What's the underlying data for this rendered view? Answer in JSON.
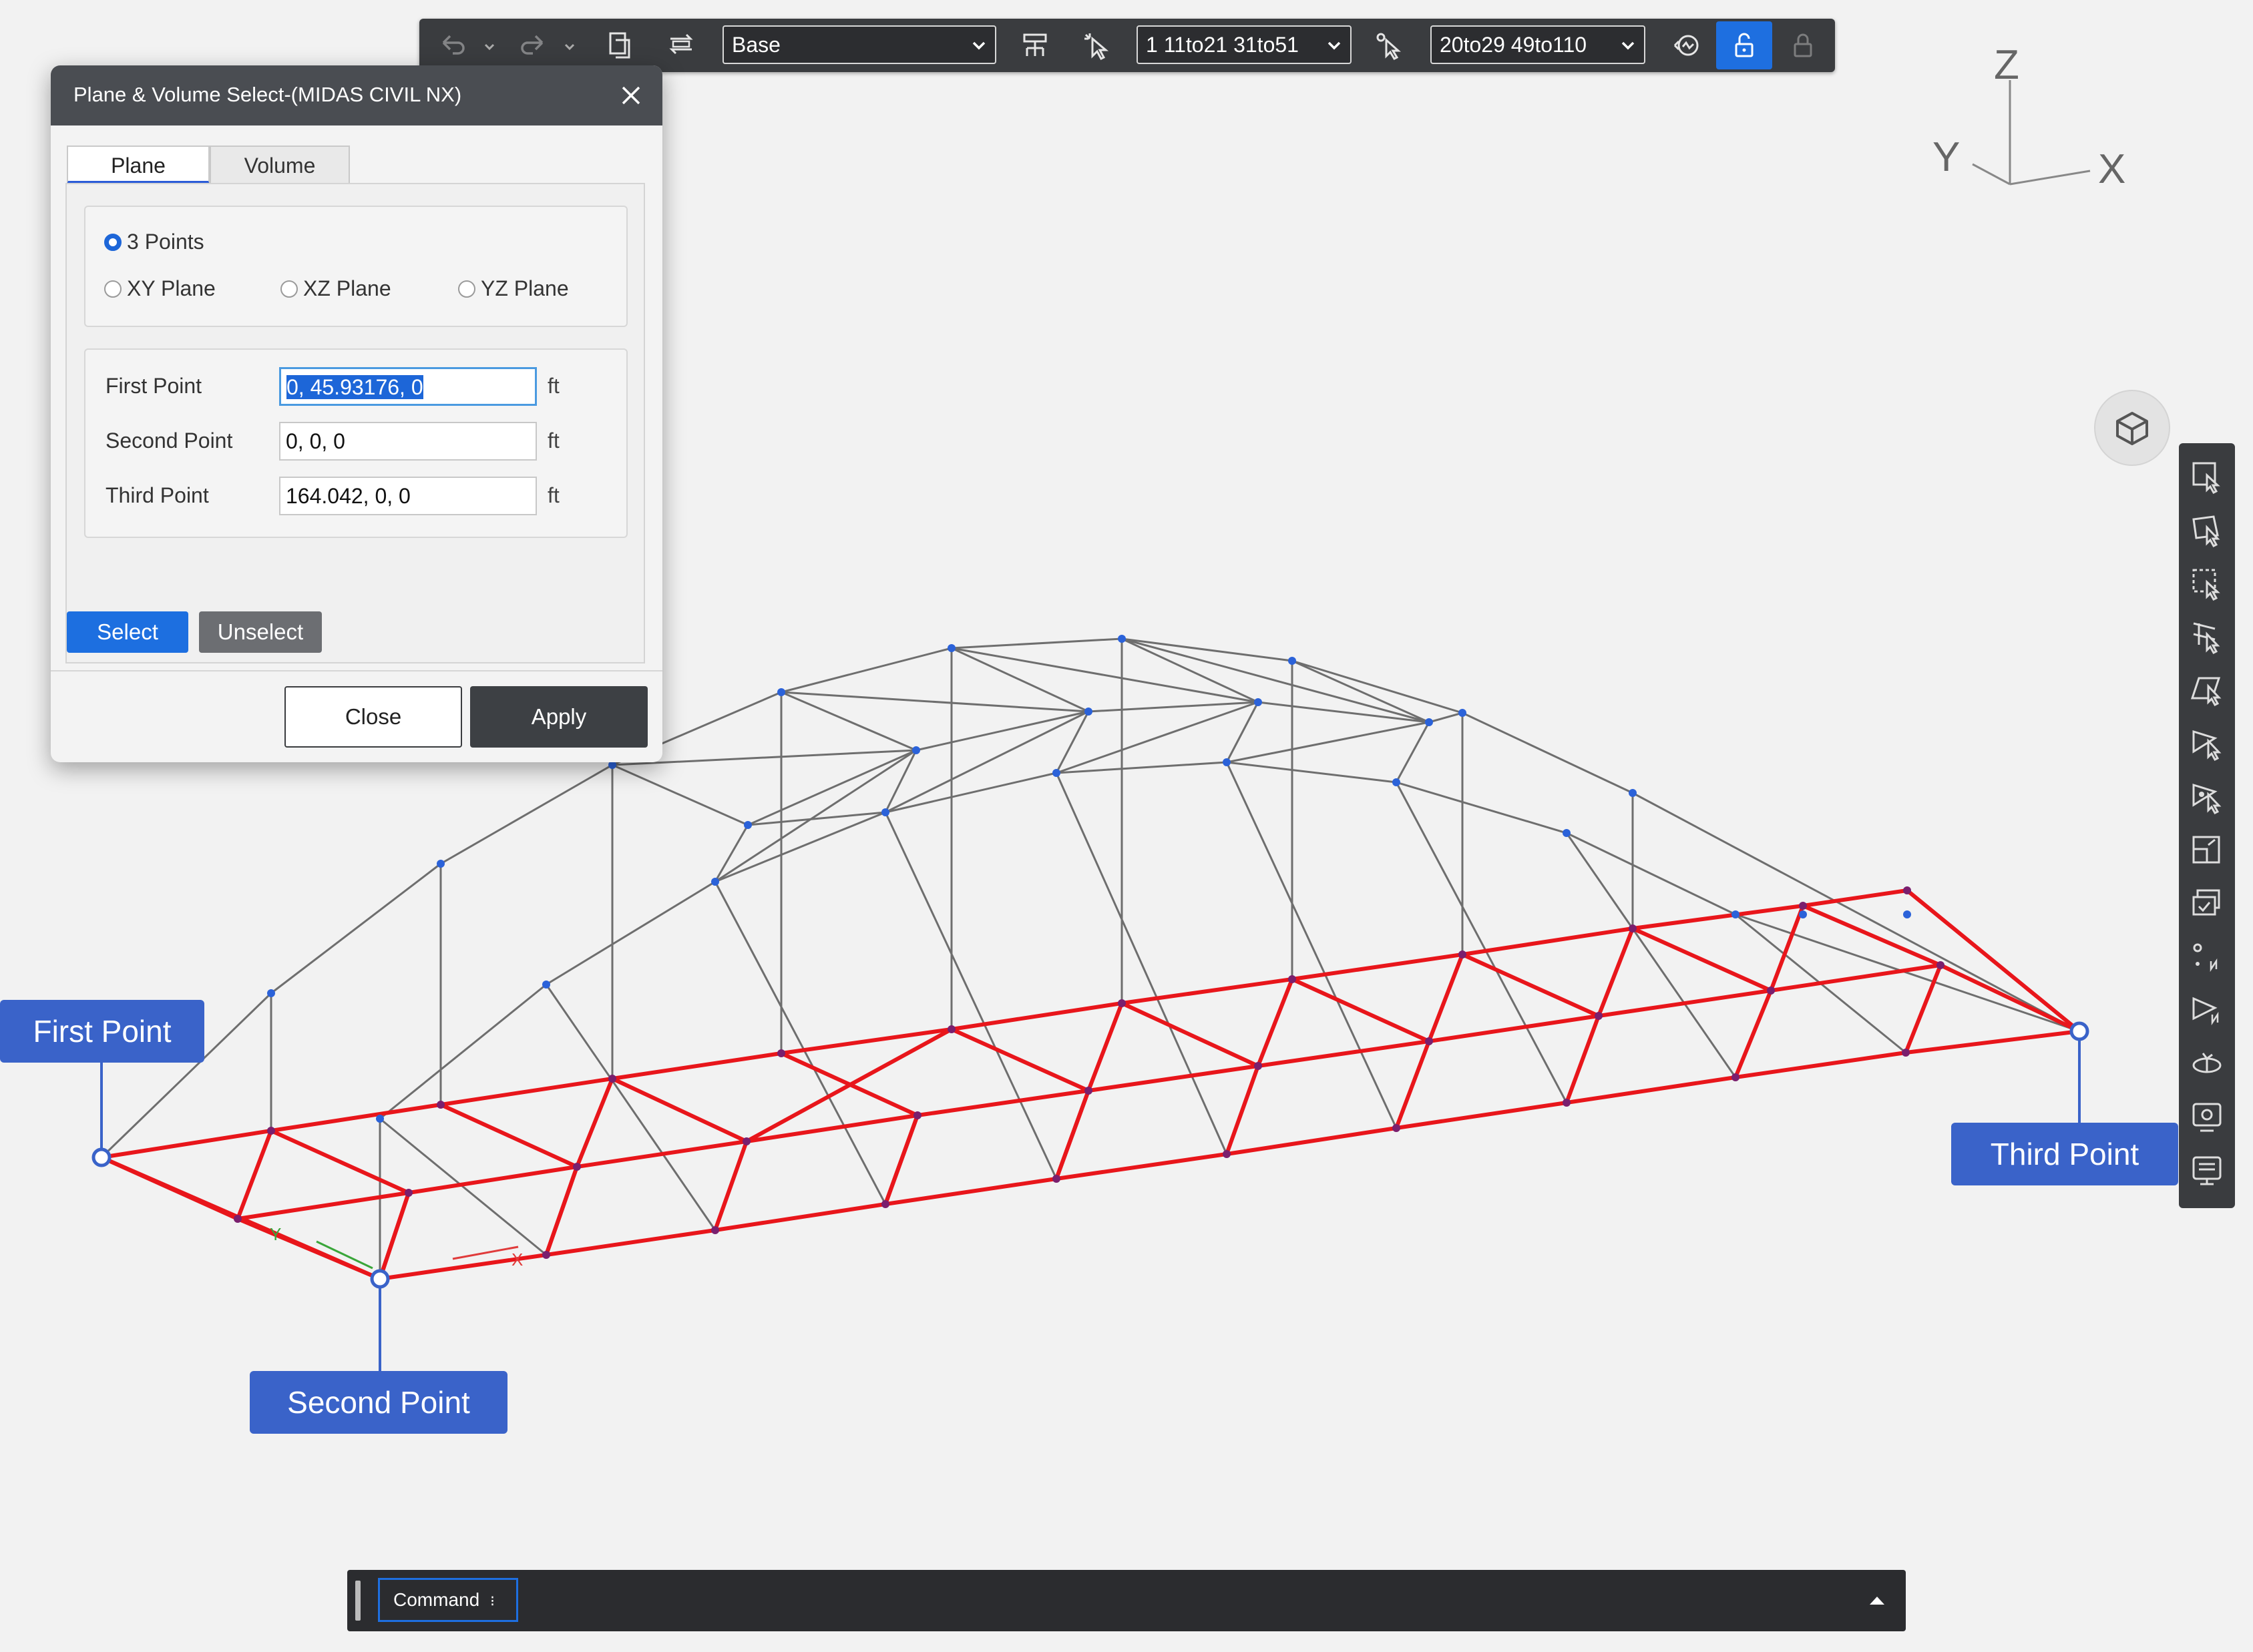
{
  "toolbar": {
    "base_select": "Base",
    "select_a": "1 11to21 31to51",
    "select_b": "20to29 49to110",
    "accent": "#1e6fe0"
  },
  "dialog": {
    "title": "Plane & Volume Select-(MIDAS CIVIL NX)",
    "tabs": [
      "Plane",
      "Volume"
    ],
    "active_tab": "Plane",
    "radios": {
      "three_points": "3 Points",
      "xy": "XY Plane",
      "xz": "XZ Plane",
      "yz": "YZ Plane",
      "selected": "3 Points"
    },
    "fields": {
      "first_label": "First Point",
      "first_value": "0, 45.93176, 0",
      "second_label": "Second Point",
      "second_value": "0, 0, 0",
      "third_label": "Third Point",
      "third_value": "164.042, 0, 0",
      "unit": "ft"
    },
    "select_label": "Select",
    "unselect_label": "Unselect",
    "close_label": "Close",
    "apply_label": "Apply"
  },
  "callouts": {
    "first": "First Point",
    "second": "Second Point",
    "third": "Third Point"
  },
  "axis": {
    "z": "Z",
    "y": "Y",
    "x": "X"
  },
  "command": {
    "label": "Command"
  },
  "colors": {
    "selected_members": "#e8161b",
    "members": "#6b6b6b",
    "nodes": "#2b62d9",
    "callout": "#3a63c9"
  }
}
